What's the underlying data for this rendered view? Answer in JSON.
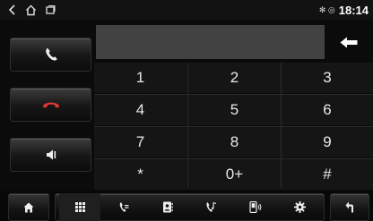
{
  "status_bar": {
    "time": "18:14",
    "indicators": "✻ ◎"
  },
  "dialer": {
    "display_value": "",
    "keys": [
      {
        "label": "1"
      },
      {
        "label": "2"
      },
      {
        "label": "3"
      },
      {
        "label": "4"
      },
      {
        "label": "5"
      },
      {
        "label": "6"
      },
      {
        "label": "7"
      },
      {
        "label": "8"
      },
      {
        "label": "9"
      },
      {
        "label": "*"
      },
      {
        "label": "0+"
      },
      {
        "label": "#"
      }
    ]
  },
  "icons": {
    "call": "phone-icon",
    "hangup": "hang-up-icon",
    "volume": "speaker-icon",
    "backspace": "backspace-arrow-icon",
    "home": "home-icon",
    "back": "return-arrow-icon",
    "tabs": [
      "dialpad-icon",
      "call-log-icon",
      "contacts-icon",
      "music-icon",
      "device-icon",
      "settings-icon"
    ]
  },
  "colors": {
    "background": "#0b0b0b",
    "display": "#424242",
    "key": "#151515",
    "accent": "#ffffff"
  }
}
